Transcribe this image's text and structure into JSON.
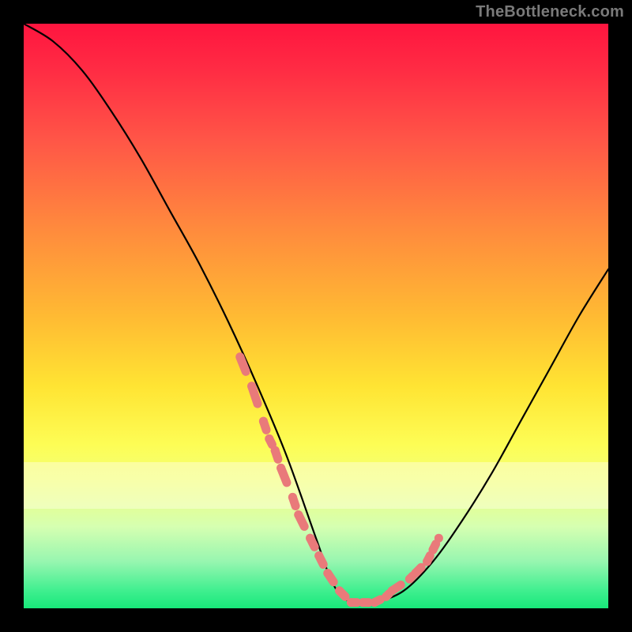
{
  "watermark": "TheBottleneck.com",
  "chart_data": {
    "type": "line",
    "title": "",
    "xlabel": "",
    "ylabel": "",
    "xlim": [
      0,
      100
    ],
    "ylim": [
      0,
      100
    ],
    "series": [
      {
        "name": "bottleneck-curve",
        "x": [
          0,
          5,
          10,
          15,
          20,
          25,
          30,
          35,
          40,
          45,
          50,
          53,
          56,
          60,
          65,
          70,
          75,
          80,
          85,
          90,
          95,
          100
        ],
        "values": [
          100,
          97,
          92,
          85,
          77,
          68,
          59,
          49,
          38,
          26,
          12,
          4,
          1,
          1,
          3,
          8,
          15,
          23,
          32,
          41,
          50,
          58
        ]
      }
    ],
    "highlight_points": {
      "name": "fit-markers",
      "color": "#e97a7a",
      "x": [
        37,
        39,
        41,
        42,
        43,
        44,
        46,
        47,
        49,
        50.5,
        52,
        54,
        56,
        58,
        60,
        62,
        63,
        66,
        67,
        69,
        70,
        71
      ],
      "values": [
        43,
        38,
        32,
        29,
        27,
        24,
        19,
        16,
        12,
        9,
        6,
        3,
        1,
        1,
        1,
        2,
        3,
        5,
        6,
        8,
        10,
        12
      ]
    },
    "gradient_meaning": "red=high bottleneck, green=low bottleneck"
  }
}
